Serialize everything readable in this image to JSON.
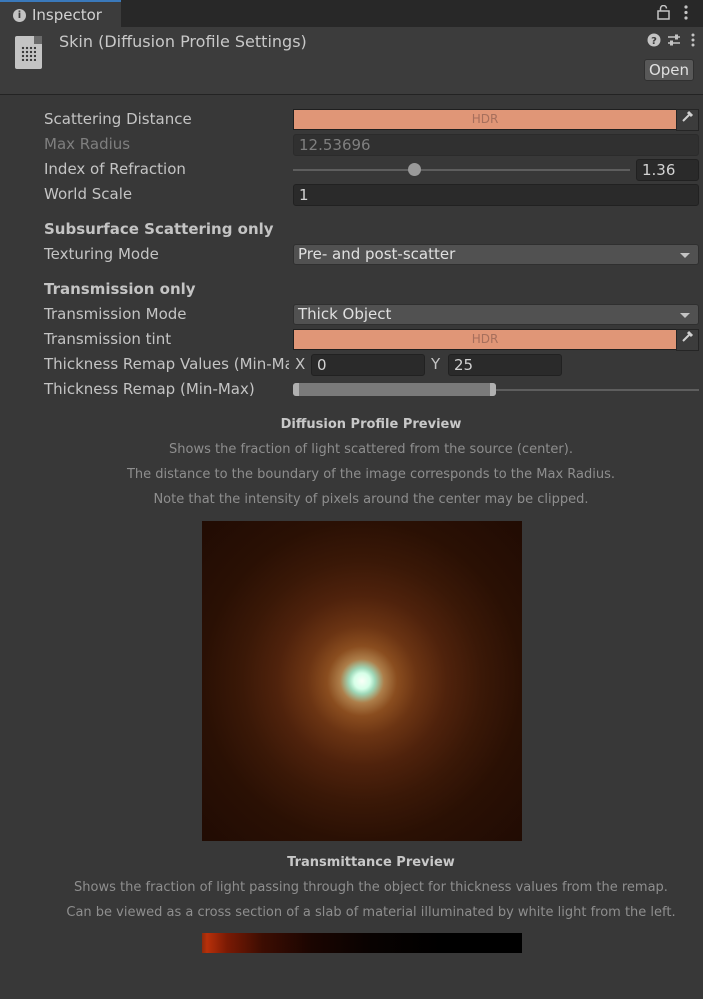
{
  "tab": {
    "label": "Inspector",
    "lock_icon": "lock-icon",
    "menu_icon": "kebab-menu-icon"
  },
  "header": {
    "title": "Skin (Diffusion Profile Settings)",
    "open_label": "Open",
    "help_icon": "help-icon",
    "presets_icon": "presets-icon",
    "menu_icon": "kebab-menu-icon"
  },
  "fields": {
    "scattering_distance": {
      "label": "Scattering Distance",
      "hdr": "HDR",
      "color": "#e09677"
    },
    "max_radius": {
      "label": "Max Radius",
      "value": "12.53696"
    },
    "index_of_refraction": {
      "label": "Index of Refraction",
      "value": "1.36",
      "slider_min": 1.0,
      "slider_max": 2.0,
      "slider_value": 1.36
    },
    "world_scale": {
      "label": "World Scale",
      "value": "1"
    }
  },
  "sss_section": {
    "heading": "Subsurface Scattering only",
    "texturing_mode": {
      "label": "Texturing Mode",
      "value": "Pre- and post-scatter"
    }
  },
  "transmission_section": {
    "heading": "Transmission only",
    "transmission_mode": {
      "label": "Transmission Mode",
      "value": "Thick Object"
    },
    "transmission_tint": {
      "label": "Transmission tint",
      "hdr": "HDR",
      "color": "#e09677"
    },
    "thickness_values": {
      "label": "Thickness Remap Values (Min-Max)",
      "x_label": "X",
      "x_value": "0",
      "y_label": "Y",
      "y_value": "25"
    },
    "thickness_range": {
      "label": "Thickness Remap (Min-Max)",
      "min_fraction": 0.0,
      "max_fraction": 0.5
    }
  },
  "diffusion_preview": {
    "title": "Diffusion Profile Preview",
    "lines": [
      "Shows the fraction of light scattered from the source (center).",
      "The distance to the boundary of the image corresponds to the Max Radius.",
      "Note that the intensity of pixels around the center may be clipped."
    ]
  },
  "transmittance_preview": {
    "title": "Transmittance Preview",
    "lines": [
      "Shows the fraction of light passing through the object for thickness values from the remap.",
      "Can be viewed as a cross section of a slab of material illuminated by white light from the left."
    ]
  }
}
